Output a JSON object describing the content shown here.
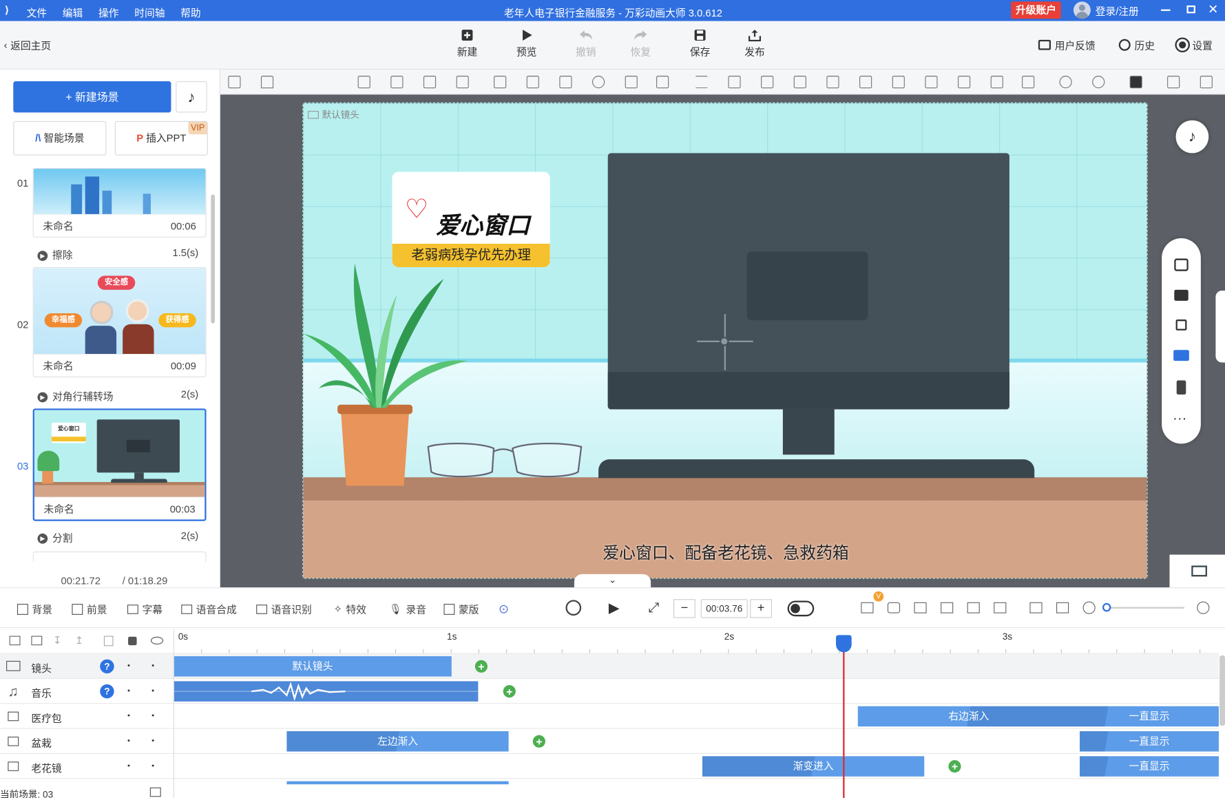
{
  "title_bar": {
    "menu": [
      "文件",
      "编辑",
      "操作",
      "时间轴",
      "帮助"
    ],
    "title": "老年人电子银行金融服务 - 万彩动画大师 3.0.612",
    "upgrade": "升级账户",
    "login": "登录/注册"
  },
  "toolbar": {
    "back": "返回主页",
    "buttons": [
      {
        "label": "新建",
        "icon": "new-icon"
      },
      {
        "label": "预览",
        "icon": "play-icon"
      },
      {
        "label": "撤销",
        "icon": "undo-icon"
      },
      {
        "label": "恢复",
        "icon": "redo-icon"
      },
      {
        "label": "保存",
        "icon": "save-icon"
      },
      {
        "label": "发布",
        "icon": "publish-icon"
      }
    ],
    "right": [
      "用户反馈",
      "历史",
      "设置"
    ]
  },
  "left_panel": {
    "new_scene": "+ 新建场景",
    "smart_scene": "智能场景",
    "insert_ppt": "插入PPT",
    "vip": "VIP",
    "scenes": [
      {
        "num": "01",
        "name": "未命名",
        "duration": "00:06",
        "transition": "擦除",
        "trans_time": "1.5(s)"
      },
      {
        "num": "02",
        "name": "未命名",
        "duration": "00:09",
        "transition": "对角行辅转场",
        "trans_time": "2(s)",
        "tags": [
          "安全感",
          "幸福感",
          "获得感"
        ]
      },
      {
        "num": "03",
        "name": "未命名",
        "duration": "00:03",
        "transition": "分割",
        "trans_time": "2(s)"
      }
    ],
    "current_time": "00:21.72",
    "total_time": "/ 01:18.29"
  },
  "stage": {
    "camera_label": "默认镜头",
    "sign_title": "爱心窗口",
    "sign_sub": "老弱病残孕优先办理",
    "subtitle": "爱心窗口、配备老花镜、急救药箱",
    "thumb_logo": "爱心窗口"
  },
  "timeline_bar": {
    "tools": [
      "背景",
      "前景",
      "字幕",
      "语音合成",
      "语音识别",
      "特效",
      "录音",
      "蒙版"
    ],
    "time": "00:03.76",
    "badge": "V"
  },
  "timeline": {
    "ruler": [
      "0s",
      "1s",
      "2s",
      "3s"
    ],
    "tracks": [
      {
        "name": "镜头",
        "clips": [
          {
            "label": "默认镜头"
          }
        ]
      },
      {
        "name": "音乐",
        "clips": []
      },
      {
        "name": "医疗包",
        "clips": [
          {
            "label": "右边渐入"
          },
          {
            "label": "一直显示"
          }
        ]
      },
      {
        "name": "盆栽",
        "clips": [
          {
            "label": "左边渐入"
          },
          {
            "label": "一直显示"
          }
        ]
      },
      {
        "name": "老花镜",
        "clips": [
          {
            "label": "渐变进入"
          },
          {
            "label": "一直显示"
          }
        ]
      }
    ],
    "current_scene": "当前场景: 03"
  },
  "colors": {
    "accent": "#2f6fe0",
    "upgrade": "#e84038",
    "stage_bg": "#b8f0f0",
    "clip": "#5d9ce8",
    "playhead": "#e0282c"
  }
}
